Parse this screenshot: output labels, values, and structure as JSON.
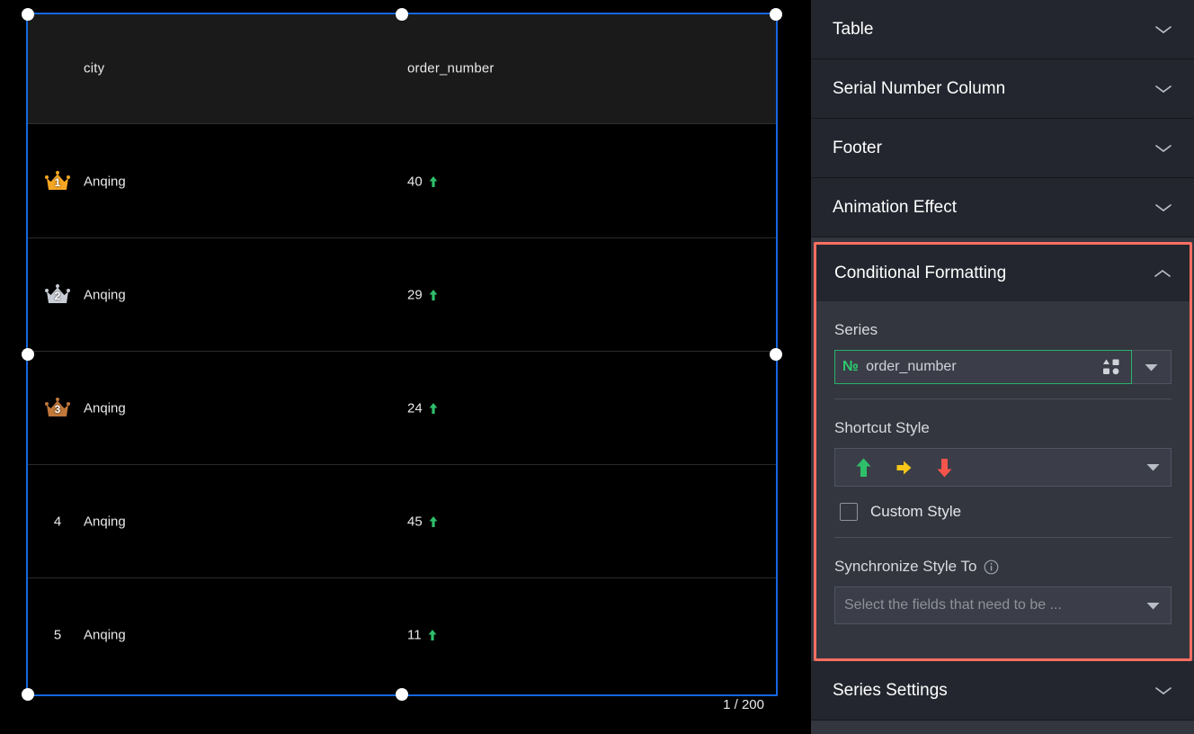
{
  "table": {
    "columns": [
      "city",
      "order_number"
    ],
    "rows": [
      {
        "rank": "1",
        "rank_medal": "gold-crown",
        "city": "Anqing",
        "order_number": "40",
        "trend": "up"
      },
      {
        "rank": "2",
        "rank_medal": "silver-crown",
        "city": "Anqing",
        "order_number": "29",
        "trend": "up"
      },
      {
        "rank": "3",
        "rank_medal": "bronze-crown",
        "city": "Anqing",
        "order_number": "24",
        "trend": "up"
      },
      {
        "rank": "4",
        "rank_medal": "",
        "city": "Anqing",
        "order_number": "45",
        "trend": "up"
      },
      {
        "rank": "5",
        "rank_medal": "",
        "city": "Anqing",
        "order_number": "11",
        "trend": "up"
      }
    ],
    "pagination": "1 / 200",
    "selected": true
  },
  "panel": {
    "sections": [
      {
        "label": "Table",
        "expanded": false,
        "chevron": "chevron-down-icon"
      },
      {
        "label": "Serial Number Column",
        "expanded": false,
        "chevron": "chevron-down-icon"
      },
      {
        "label": "Footer",
        "expanded": false,
        "chevron": "chevron-down-icon"
      },
      {
        "label": "Animation Effect",
        "expanded": false,
        "chevron": "chevron-down-icon"
      },
      {
        "label": "Series Settings",
        "expanded": false,
        "chevron": "chevron-down-icon"
      }
    ],
    "conditional_formatting": {
      "title": "Conditional Formatting",
      "chevron": "chevron-up-icon",
      "expanded": true,
      "highlighted": true,
      "series": {
        "label": "Series",
        "value": "order_number",
        "field_type_icon": "number-sign-icon",
        "shapes_icon": "shapes-icon",
        "caret": "caret-down-icon"
      },
      "shortcut_style": {
        "label": "Shortcut Style",
        "arrows": [
          "up-arrow-green",
          "right-arrow-yellow",
          "down-arrow-red"
        ],
        "caret": "caret-down-icon"
      },
      "custom_style": {
        "label": "Custom Style",
        "checked": false
      },
      "synchronize": {
        "label": "Synchronize Style To",
        "info_icon": "info-icon",
        "placeholder": "Select the fields that need to be ...",
        "value": "",
        "caret": "caret-down-icon"
      }
    }
  },
  "colors": {
    "selection_blue": "#1667e0",
    "highlight_red": "#ff6f61",
    "accent_green": "#2ecc71",
    "arrow_up": "#2fbf6b",
    "arrow_right": "#f5c518",
    "arrow_down": "#f4544c",
    "panel_bg": "#33363f",
    "section_bg": "#23262e",
    "canvas_bg": "#000000",
    "crown_gold": "#f5a623",
    "crown_silver": "#c8ccd4",
    "crown_bronze": "#c1783a"
  }
}
